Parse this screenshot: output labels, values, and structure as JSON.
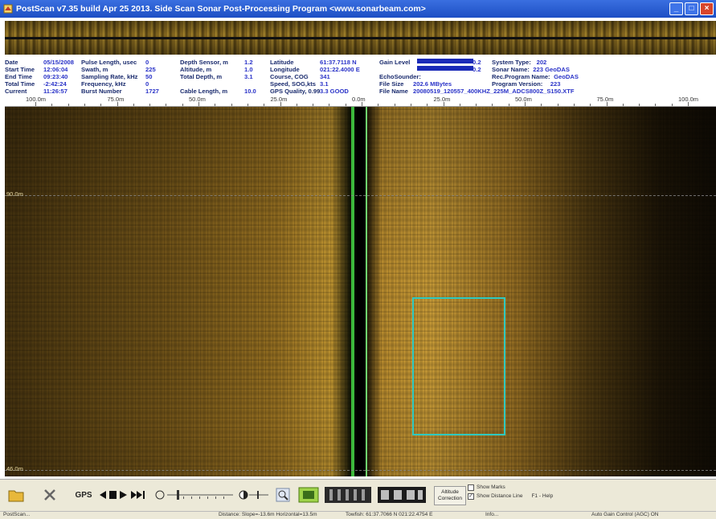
{
  "window": {
    "title": "PostScan v7.35 build Apr 25 2013. Side Scan Sonar Post-Processing Program  <www.sonarbeam.com>",
    "minimize_label": "_",
    "maximize_label": "□",
    "close_label": "×"
  },
  "info": {
    "col1": [
      {
        "label": "Date",
        "value": "05/15/2008"
      },
      {
        "label": "Start Time",
        "value": "12:06:04"
      },
      {
        "label": "End  Time",
        "value": "09:23:40"
      },
      {
        "label": "Total Time",
        "value": "-2:42:24"
      },
      {
        "label": "Current",
        "value": "11:26:57"
      }
    ],
    "col2": [
      {
        "label": "Pulse Length, usec",
        "value": "0"
      },
      {
        "label": "Swath, m",
        "value": "225"
      },
      {
        "label": "Sampling Rate, kHz",
        "value": "50"
      },
      {
        "label": "Frequency, kHz",
        "value": "0"
      },
      {
        "label": "Burst Number",
        "value": "1727"
      }
    ],
    "col3": [
      {
        "label": "Depth Sensor, m",
        "value": "1.2"
      },
      {
        "label": "Altitude, m",
        "value": "1.0"
      },
      {
        "label": "Total Depth, m",
        "value": "3.1"
      },
      {
        "label": "",
        "value": ""
      },
      {
        "label": "Cable Length, m",
        "value": "10.0"
      }
    ],
    "col4": [
      {
        "label": "Latitude",
        "value": "61:37.7118 N"
      },
      {
        "label": "Longitude",
        "value": "021:22.4000 E"
      },
      {
        "label": "Course, COG",
        "value": "341"
      },
      {
        "label": "Speed, SOG,kts",
        "value": "3.1"
      },
      {
        "label": "GPS Quality, 0.99",
        "value": "3.3 GOOD"
      }
    ],
    "col5": [
      {
        "label": "Gain Level",
        "value": "0.2"
      },
      {
        "label": "",
        "value": "0.2"
      },
      {
        "label": "EchoSounder:",
        "value": ""
      },
      {
        "label": "File Size",
        "value": "202.6 MBytes"
      },
      {
        "label": "File Name",
        "value": "20080519_120557_400KHZ_225M_ADCS800Z_S150.XTF"
      }
    ],
    "col6": [
      {
        "label": "System Type:",
        "value": "202"
      },
      {
        "label": "Sonar Name:",
        "value": "223 GeoDAS"
      },
      {
        "label": "Rec.Program Name:",
        "value": "GeoDAS"
      },
      {
        "label": "Program Version:",
        "value": "223"
      }
    ],
    "gain_color": "#1a2ab8"
  },
  "ruler": {
    "labels": [
      "100.0m",
      "75.0m",
      "50.0m",
      "25.0m",
      "0.0m",
      "25.0m",
      "50.0m",
      "75.0m",
      "100.0m"
    ]
  },
  "sonar": {
    "range_labels": [
      "90.0m",
      "46.0m"
    ],
    "box_color": "#2ec9c0"
  },
  "toolbar": {
    "gps_label": "GPS",
    "altitude_label": "Altitude\nCorrection",
    "show_marks_label": "Show Marks",
    "show_distance_label": "Show Distance Line",
    "help_label": "F1 - Help",
    "show_marks_checked": false,
    "show_distance_checked": true
  },
  "status": {
    "app": "PostScan...",
    "distance": "Distance: Slope=-13.6m Horizontal=13.5m",
    "towfish": "Towfish: 61:37.7066 N   021:22.4754 E",
    "info": "Info...",
    "agc": "Auto Gain Control (AGC) ON"
  }
}
